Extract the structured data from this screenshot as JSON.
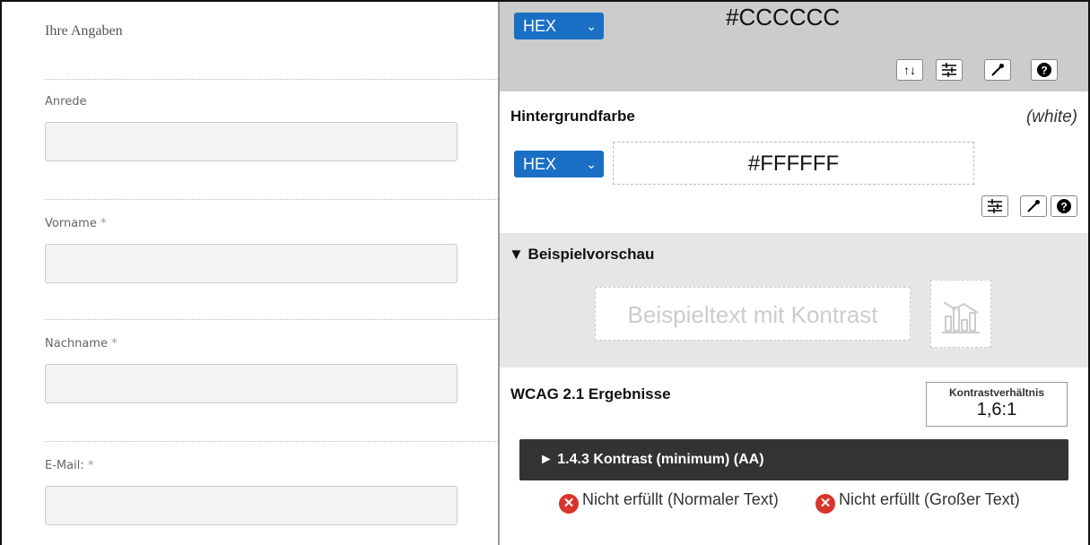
{
  "form": {
    "section_title": "Ihre Angaben",
    "fields": [
      {
        "label": "Anrede",
        "required": ""
      },
      {
        "label": "Vorname",
        "required": "*"
      },
      {
        "label": "Nachname",
        "required": "*"
      },
      {
        "label": "E-Mail:",
        "required": "*"
      }
    ]
  },
  "checker": {
    "foreground": {
      "format": "HEX",
      "value": "#CCCCCC",
      "tools": [
        "swap-icon",
        "sliders-icon",
        "eyedropper-icon",
        "help-icon"
      ],
      "swap_label": "↑↓"
    },
    "background": {
      "title": "Hintergrundfarbe",
      "color_name": "(white)",
      "format": "HEX",
      "value": "#FFFFFF",
      "tools": [
        "sliders-icon",
        "eyedropper-icon",
        "help-icon"
      ]
    },
    "preview": {
      "title": "▼ Beispielvorschau",
      "sample_text": "Beispieltext mit Kontrast"
    },
    "results": {
      "title": "WCAG 2.1 Ergebnisse",
      "ratio_label": "Kontrastverhältnis",
      "ratio_value": "1,6:1",
      "criterion": "► 1.4.3 Kontrast (minimum) (AA)",
      "normal_text": "Nicht erfüllt (Normaler Text)",
      "large_text": "Nicht erfüllt (Großer Text)"
    },
    "colors": {
      "select_blue": "#1a6fc4",
      "fail_red": "#d9342b",
      "fg_panel": "#cccccc",
      "preview_bg": "#e6e6e6"
    }
  }
}
